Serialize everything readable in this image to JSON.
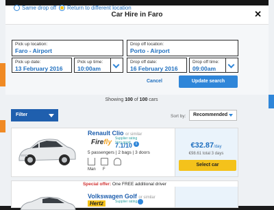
{
  "modal": {
    "title": "Car Hire in Faro",
    "close_symbol": "✕"
  },
  "trip_options": {
    "same_drop_off": "Same drop off",
    "different_drop_off": "Return to different location",
    "selected": "different_drop_off"
  },
  "form": {
    "pickup_location": {
      "label": "Pick up location:",
      "value": "Faro - Airport"
    },
    "dropoff_location": {
      "label": "Drop off location:",
      "value": "Porto - Airport"
    },
    "pickup_date": {
      "label": "Pick up date:",
      "value": "13 February 2016"
    },
    "pickup_time": {
      "label": "Pick up time:",
      "value": "10:00am"
    },
    "dropoff_date": {
      "label": "Drop off date:",
      "value": "16 February 2016"
    },
    "dropoff_time": {
      "label": "Drop off time:",
      "value": "09:00am"
    },
    "cancel_label": "Cancel",
    "update_label": "Update search"
  },
  "results": {
    "showing_prefix": "Showing ",
    "shown_count": "100",
    "of_text": " of ",
    "total_count": "100",
    "suffix": " cars",
    "filter_label": "Filter",
    "sort_label": "Sort by:",
    "sort_value": "Recommended"
  },
  "cars": [
    {
      "name": "Renault Clio",
      "or_similar": "or similar",
      "supplier_text_a": "Fire",
      "supplier_text_b": "fly",
      "rating_label_1": "Supplier rating",
      "rating_label_2": "Very good",
      "rating": "7.1/10",
      "specs": "5 passengers  |  2 bags  |  3 doors",
      "transmission": "Man",
      "fuel_label": "F",
      "price": "€32.87",
      "per_day": "/day",
      "total": "€98.61 total 3 days",
      "select_label": "Select car"
    },
    {
      "offer_prefix": "Special offer:",
      "offer_text": " One FREE additional driver",
      "name": "Volkswagen Golf",
      "or_similar": "or similar",
      "supplier": "Hertz",
      "rating_label": "Supplier rating"
    }
  ],
  "colors": {
    "accent_blue": "#2f86d9",
    "cta_yellow": "#f4c21b",
    "price_blue": "#1f6fbf"
  }
}
